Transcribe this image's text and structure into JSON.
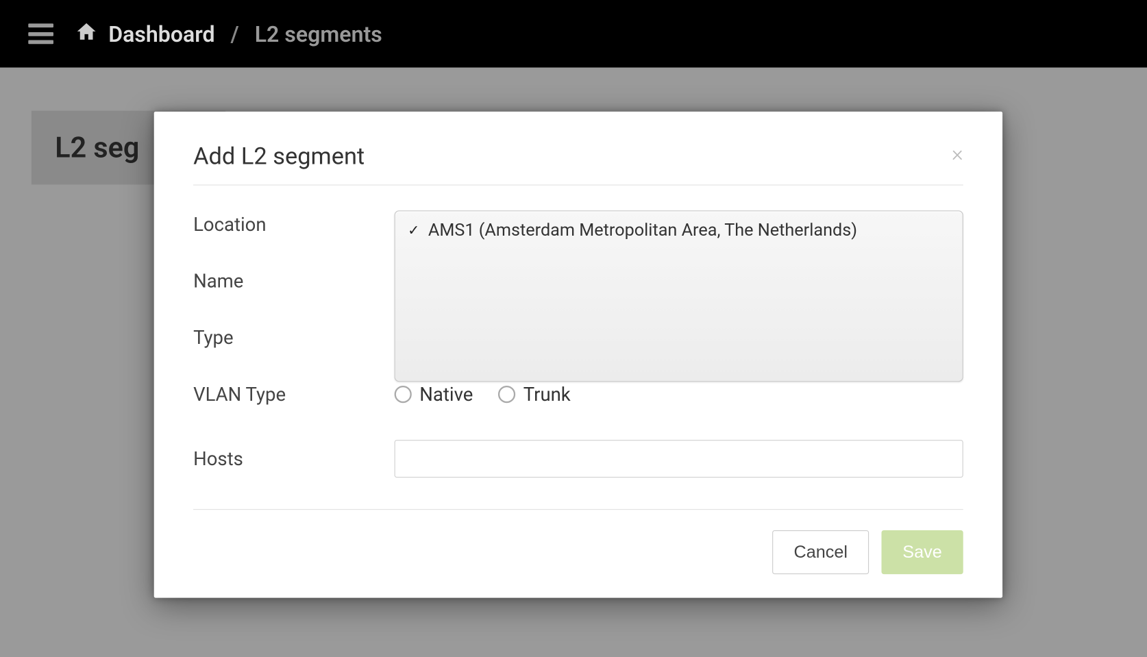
{
  "topbar": {
    "breadcrumb": {
      "home_label": "Dashboard",
      "separator": "/",
      "current": "L2 segments"
    }
  },
  "page": {
    "title_truncated": "L2 seg"
  },
  "modal": {
    "title": "Add L2 segment",
    "close_symbol": "×",
    "fields": {
      "location": {
        "label": "Location",
        "options": [
          {
            "label": "AMS1 (Amsterdam Metropolitan Area, The Netherlands)",
            "selected": true
          }
        ]
      },
      "name": {
        "label": "Name",
        "value": ""
      },
      "type": {
        "label": "Type"
      },
      "vlan_type": {
        "label": "VLAN Type",
        "options": [
          {
            "label": "Native",
            "selected": false
          },
          {
            "label": "Trunk",
            "selected": false
          }
        ]
      },
      "hosts": {
        "label": "Hosts",
        "value": ""
      }
    },
    "buttons": {
      "cancel": "Cancel",
      "save": "Save"
    }
  }
}
